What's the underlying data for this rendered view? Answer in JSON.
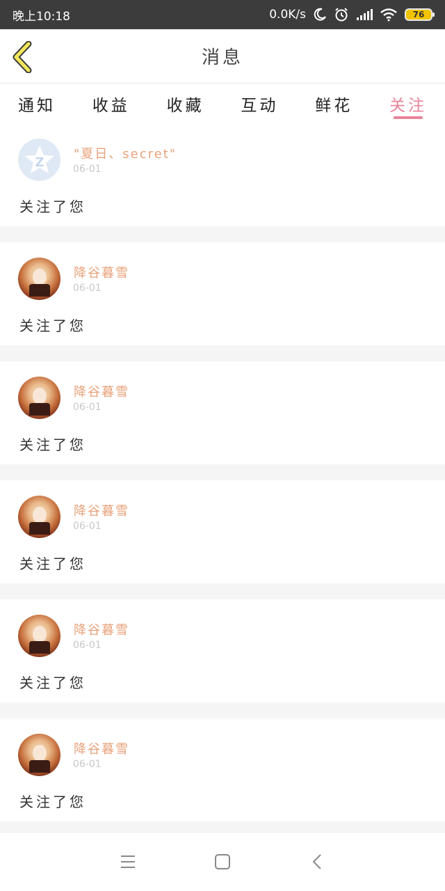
{
  "status_bar": {
    "time": "晚上10:18",
    "net_speed": "0.0K/s",
    "battery": "76"
  },
  "header": {
    "title": "消息"
  },
  "tabs": [
    {
      "label": "通知"
    },
    {
      "label": "收益"
    },
    {
      "label": "收藏"
    },
    {
      "label": "互动"
    },
    {
      "label": "鲜花"
    },
    {
      "label": "关注"
    }
  ],
  "active_tab": "关注",
  "colors": {
    "accent": "#e8849a",
    "username": "#e8a27a",
    "back_arrow": "#f2e65a"
  },
  "messages": [
    {
      "name": "\"夏日、secret\"",
      "date": "06-01",
      "text": "关注了您",
      "avatar": "default-avatar"
    },
    {
      "name": "降谷暮雪",
      "date": "06-01",
      "text": "关注了您",
      "avatar": "anime-avatar"
    },
    {
      "name": "降谷暮雪",
      "date": "06-01",
      "text": "关注了您",
      "avatar": "anime-avatar"
    },
    {
      "name": "降谷暮雪",
      "date": "06-01",
      "text": "关注了您",
      "avatar": "anime-avatar"
    },
    {
      "name": "降谷暮雪",
      "date": "06-01",
      "text": "关注了您",
      "avatar": "anime-avatar"
    },
    {
      "name": "降谷暮雪",
      "date": "06-01",
      "text": "关注了您",
      "avatar": "anime-avatar"
    }
  ],
  "nav": {
    "icons": [
      "menu-icon",
      "home-icon",
      "back-icon"
    ]
  }
}
